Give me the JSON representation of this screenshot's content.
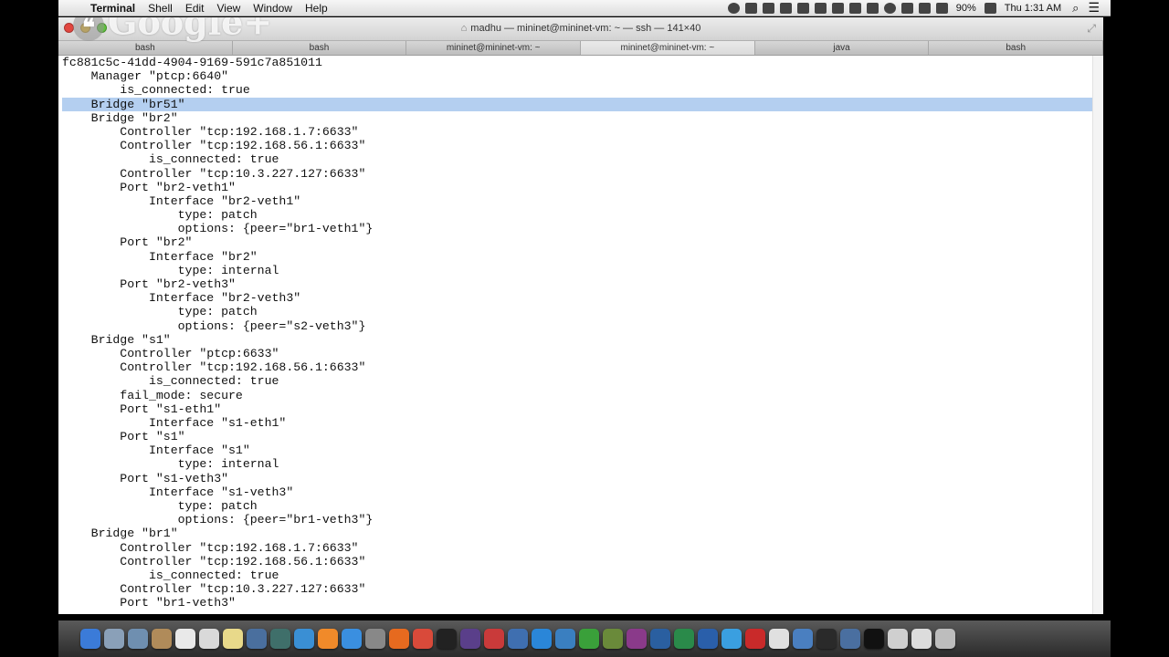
{
  "menubar": {
    "app_name": "Terminal",
    "menus": [
      "Shell",
      "Edit",
      "View",
      "Window",
      "Help"
    ],
    "battery": "90%",
    "clock": "Thu 1:31 AM"
  },
  "window": {
    "title": "madhu — mininet@mininet-vm: ~ — ssh — 141×40",
    "overlay": "Google+",
    "tabs": [
      {
        "label": "bash",
        "active": false
      },
      {
        "label": "bash",
        "active": false
      },
      {
        "label": "mininet@mininet-vm: ~",
        "active": false
      },
      {
        "label": "mininet@mininet-vm: ~",
        "active": true
      },
      {
        "label": "java",
        "active": false
      },
      {
        "label": "bash",
        "active": false
      }
    ]
  },
  "terminal": {
    "selected_index": 3,
    "lines": [
      "fc881c5c-41dd-4904-9169-591c7a851011",
      "    Manager \"ptcp:6640\"",
      "        is_connected: true",
      "    Bridge \"br51\"",
      "    Bridge \"br2\"",
      "        Controller \"tcp:192.168.1.7:6633\"",
      "        Controller \"tcp:192.168.56.1:6633\"",
      "            is_connected: true",
      "        Controller \"tcp:10.3.227.127:6633\"",
      "        Port \"br2-veth1\"",
      "            Interface \"br2-veth1\"",
      "                type: patch",
      "                options: {peer=\"br1-veth1\"}",
      "        Port \"br2\"",
      "            Interface \"br2\"",
      "                type: internal",
      "        Port \"br2-veth3\"",
      "            Interface \"br2-veth3\"",
      "                type: patch",
      "                options: {peer=\"s2-veth3\"}",
      "    Bridge \"s1\"",
      "        Controller \"ptcp:6633\"",
      "        Controller \"tcp:192.168.56.1:6633\"",
      "            is_connected: true",
      "        fail_mode: secure",
      "        Port \"s1-eth1\"",
      "            Interface \"s1-eth1\"",
      "        Port \"s1\"",
      "            Interface \"s1\"",
      "                type: internal",
      "        Port \"s1-veth3\"",
      "            Interface \"s1-veth3\"",
      "                type: patch",
      "                options: {peer=\"br1-veth3\"}",
      "    Bridge \"br1\"",
      "        Controller \"tcp:192.168.1.7:6633\"",
      "        Controller \"tcp:192.168.56.1:6633\"",
      "            is_connected: true",
      "        Controller \"tcp:10.3.227.127:6633\"",
      "        Port \"br1-veth3\""
    ]
  },
  "dock_icons": [
    {
      "name": "finder",
      "color": "#3b7bd8"
    },
    {
      "name": "safari-compass",
      "color": "#8aa0b8"
    },
    {
      "name": "mail",
      "color": "#6f8fb0"
    },
    {
      "name": "contacts",
      "color": "#b08b5a"
    },
    {
      "name": "calendar",
      "color": "#e9e9e9"
    },
    {
      "name": "preview",
      "color": "#d9d9d9"
    },
    {
      "name": "notes",
      "color": "#e8d98a"
    },
    {
      "name": "photo-booth",
      "color": "#4a6f9e"
    },
    {
      "name": "image-capture",
      "color": "#3f6f6a"
    },
    {
      "name": "itunes",
      "color": "#3a8fd4"
    },
    {
      "name": "ibooks",
      "color": "#f08a2a"
    },
    {
      "name": "app-store",
      "color": "#3a8fe0"
    },
    {
      "name": "system-preferences",
      "color": "#888888"
    },
    {
      "name": "firefox",
      "color": "#e66a1f"
    },
    {
      "name": "chrome",
      "color": "#d94a3a"
    },
    {
      "name": "terminal",
      "color": "#222222"
    },
    {
      "name": "eclipse",
      "color": "#5a3f8a"
    },
    {
      "name": "sticky-app",
      "color": "#c93a3a"
    },
    {
      "name": "virtualbox",
      "color": "#3f6fb0"
    },
    {
      "name": "skype-like",
      "color": "#2a86d8"
    },
    {
      "name": "shark",
      "color": "#3a7fc0"
    },
    {
      "name": "minecraft",
      "color": "#3aa03a"
    },
    {
      "name": "game",
      "color": "#6a8a3a"
    },
    {
      "name": "app-purple",
      "color": "#8a3a8a"
    },
    {
      "name": "wireshark",
      "color": "#2a5fa0"
    },
    {
      "name": "excel",
      "color": "#2a8a4a"
    },
    {
      "name": "word",
      "color": "#2a5faa"
    },
    {
      "name": "twitter",
      "color": "#3a9fe0"
    },
    {
      "name": "acrobat",
      "color": "#c92a2a"
    },
    {
      "name": "pages",
      "color": "#e0e0e0"
    },
    {
      "name": "keynote",
      "color": "#4a7fc0"
    },
    {
      "name": "activity-monitor",
      "color": "#2a2a2a"
    },
    {
      "name": "virtualbox-2",
      "color": "#4a6fa0"
    },
    {
      "name": "terminal-2",
      "color": "#111111"
    },
    {
      "name": "magnifier",
      "color": "#cfcfcf"
    },
    {
      "name": "documents",
      "color": "#dcdcdc"
    },
    {
      "name": "trash",
      "color": "#bdbdbd"
    }
  ]
}
